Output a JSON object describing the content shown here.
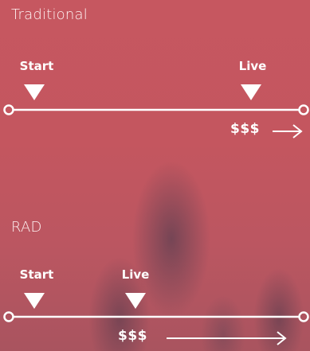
{
  "traditional": {
    "title": "Traditional",
    "start_label": "Start",
    "live_label": "Live",
    "cost_label": "$$$"
  },
  "rad": {
    "title": "RAD",
    "start_label": "Start",
    "live_label": "Live",
    "cost_label": "$$$"
  },
  "colors": {
    "background": "#c4565f",
    "foreground": "#ffffff"
  }
}
